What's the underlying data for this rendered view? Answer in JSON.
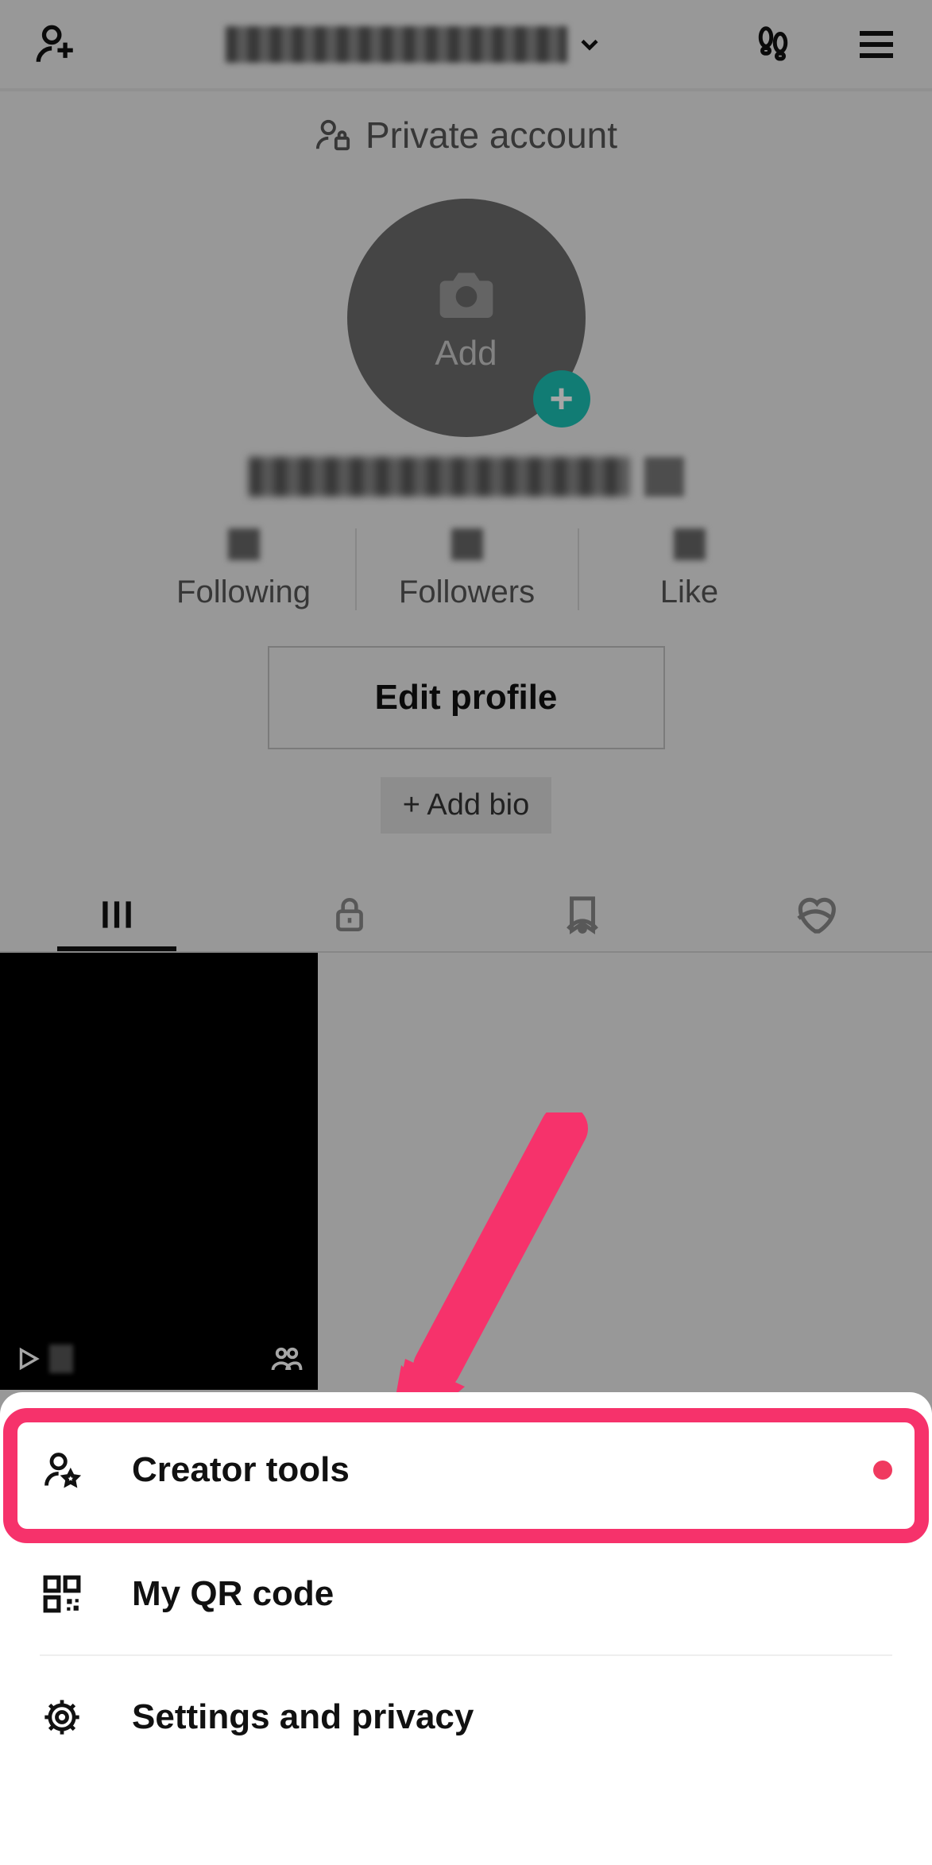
{
  "header": {
    "username_obscured": true
  },
  "privacy_banner": "Private account",
  "avatar": {
    "add_label": "Add"
  },
  "profile": {
    "username_obscured": true
  },
  "stats": {
    "following": {
      "label": "Following"
    },
    "followers": {
      "label": "Followers"
    },
    "likes": {
      "label": "Like"
    }
  },
  "buttons": {
    "edit_profile": "Edit profile",
    "add_bio": "+ Add bio"
  },
  "tabs": {
    "grid": "grid-icon",
    "private": "lock-icon",
    "saved": "bookmark-hidden-icon",
    "liked": "heart-hidden-icon"
  },
  "menu": {
    "items": [
      {
        "label": "Creator tools",
        "icon": "person-star-icon",
        "has_badge": true
      },
      {
        "label": "My QR code",
        "icon": "qr-icon",
        "has_badge": false
      },
      {
        "label": "Settings and privacy",
        "icon": "gear-icon",
        "has_badge": false
      }
    ]
  },
  "annotation": {
    "highlight_target": "Creator tools"
  }
}
